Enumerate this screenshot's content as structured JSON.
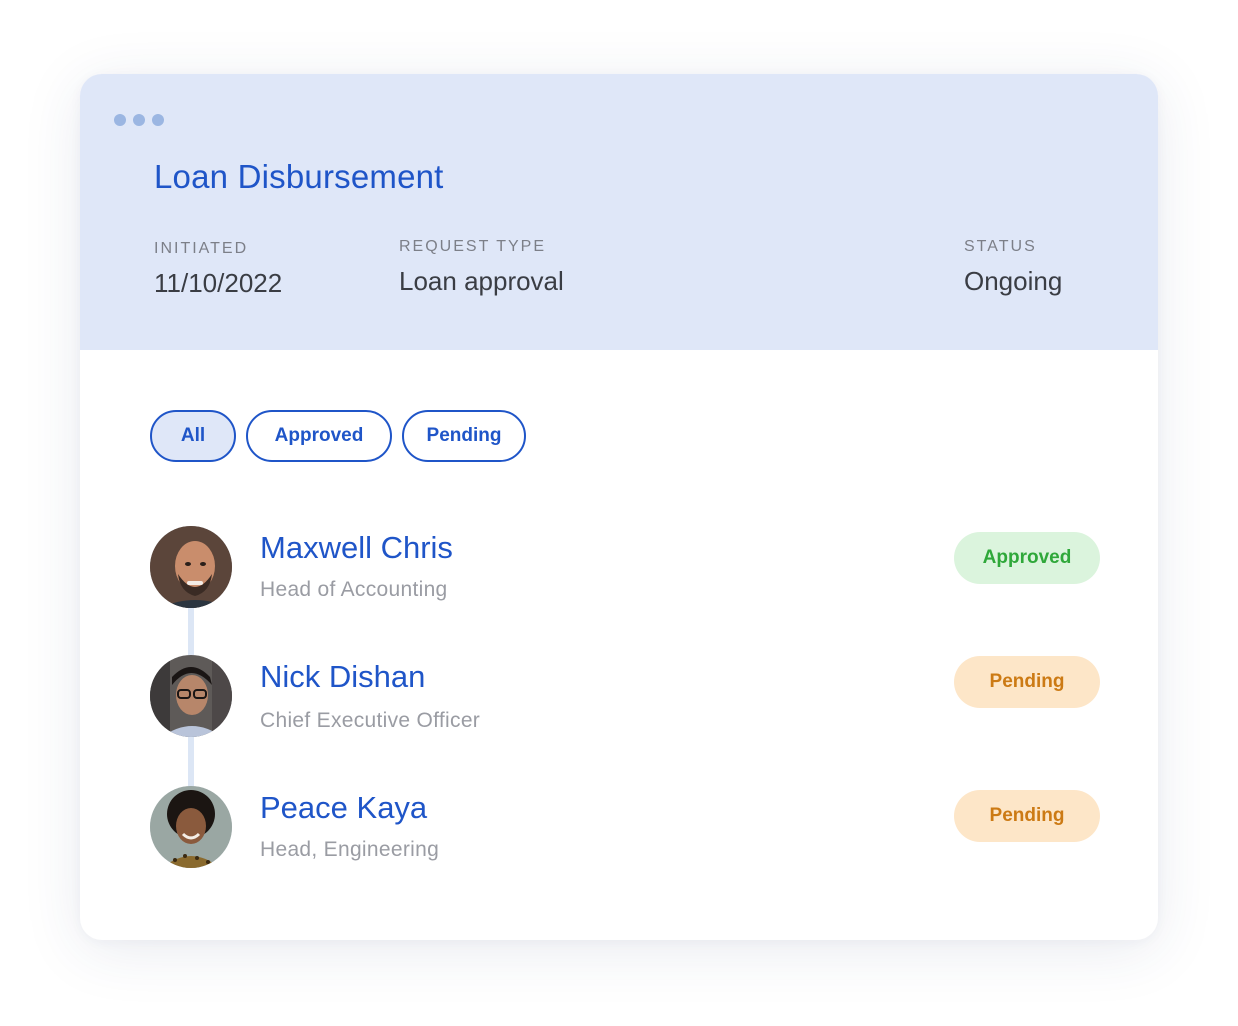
{
  "request": {
    "title": "Loan Disbursement",
    "initiated_label": "INITIATED",
    "initiated_value": "11/10/2022",
    "request_type_label": "REQUEST TYPE",
    "request_type_value": "Loan approval",
    "status_label": "STATUS",
    "status_value": "Ongoing"
  },
  "filters": [
    {
      "label": "All",
      "active": true
    },
    {
      "label": "Approved",
      "active": false
    },
    {
      "label": "Pending",
      "active": false
    }
  ],
  "approvers": [
    {
      "name": "Maxwell Chris",
      "role": "Head of Accounting",
      "status": "Approved",
      "status_color": "#2fa83a",
      "status_bg": "#dbf4dd"
    },
    {
      "name": "Nick Dishan",
      "role": "Chief Executive Officer",
      "status": "Pending",
      "status_color": "#cc7a14",
      "status_bg": "#fde6c8"
    },
    {
      "name": "Peace Kaya",
      "role": "Head, Engineering",
      "status": "Pending",
      "status_color": "#cc7a14",
      "status_bg": "#fde6c8"
    }
  ],
  "colors": {
    "accent": "#1f55c8",
    "header_bg": "#dfe7f8",
    "timeline": "#dce6f5"
  }
}
